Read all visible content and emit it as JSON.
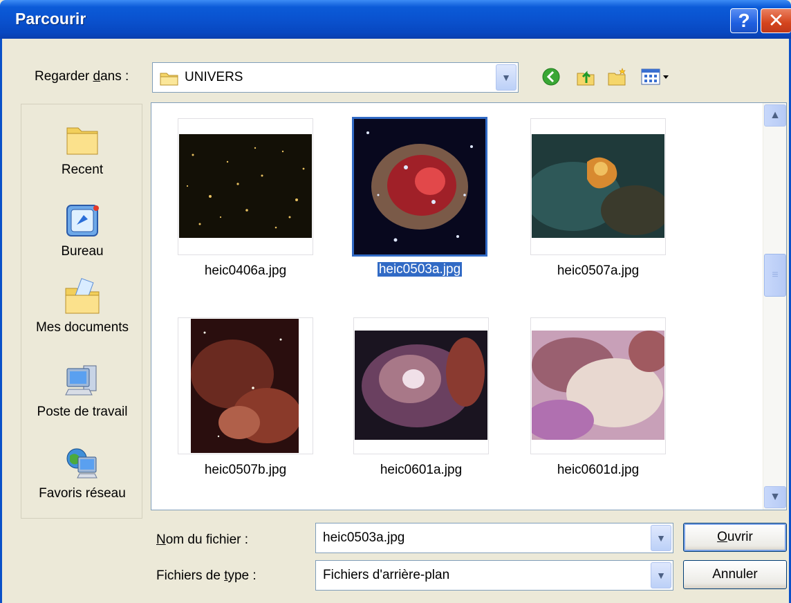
{
  "window": {
    "title": "Parcourir",
    "help_label": "?",
    "close_label": "✕"
  },
  "lookin": {
    "label_pre": "Regarder ",
    "label_accel": "d",
    "label_post": "ans :",
    "value": "UNIVERS",
    "toolbar_icons": [
      "back-icon",
      "up-folder-icon",
      "new-folder-icon",
      "view-menu-icon"
    ]
  },
  "places": [
    {
      "label": "Recent",
      "icon": "recent-folder-icon"
    },
    {
      "label": "Bureau",
      "icon": "desktop-icon"
    },
    {
      "label": "Mes documents",
      "icon": "my-documents-icon"
    },
    {
      "label": "Poste de travail",
      "icon": "my-computer-icon"
    },
    {
      "label": "Favoris réseau",
      "icon": "network-places-icon"
    }
  ],
  "files": [
    {
      "name": "heic0406a.jpg",
      "selected": false
    },
    {
      "name": "heic0503a.jpg",
      "selected": true
    },
    {
      "name": "heic0507a.jpg",
      "selected": false
    },
    {
      "name": "heic0507b.jpg",
      "selected": false
    },
    {
      "name": "heic0601a.jpg",
      "selected": false
    },
    {
      "name": "heic0601d.jpg",
      "selected": false
    }
  ],
  "filename": {
    "label_accel": "N",
    "label_post": "om du fichier :",
    "value": "heic0503a.jpg"
  },
  "filetype": {
    "label_pre": "Fichiers de ",
    "label_accel": "t",
    "label_post": "ype :",
    "value": "Fichiers d'arrière-plan"
  },
  "buttons": {
    "open_accel": "O",
    "open_post": "uvrir",
    "cancel": "Annuler"
  },
  "colors": {
    "titlebar": "#0a52cf",
    "selection": "#316ac5",
    "dialog_bg": "#ece9d8"
  }
}
